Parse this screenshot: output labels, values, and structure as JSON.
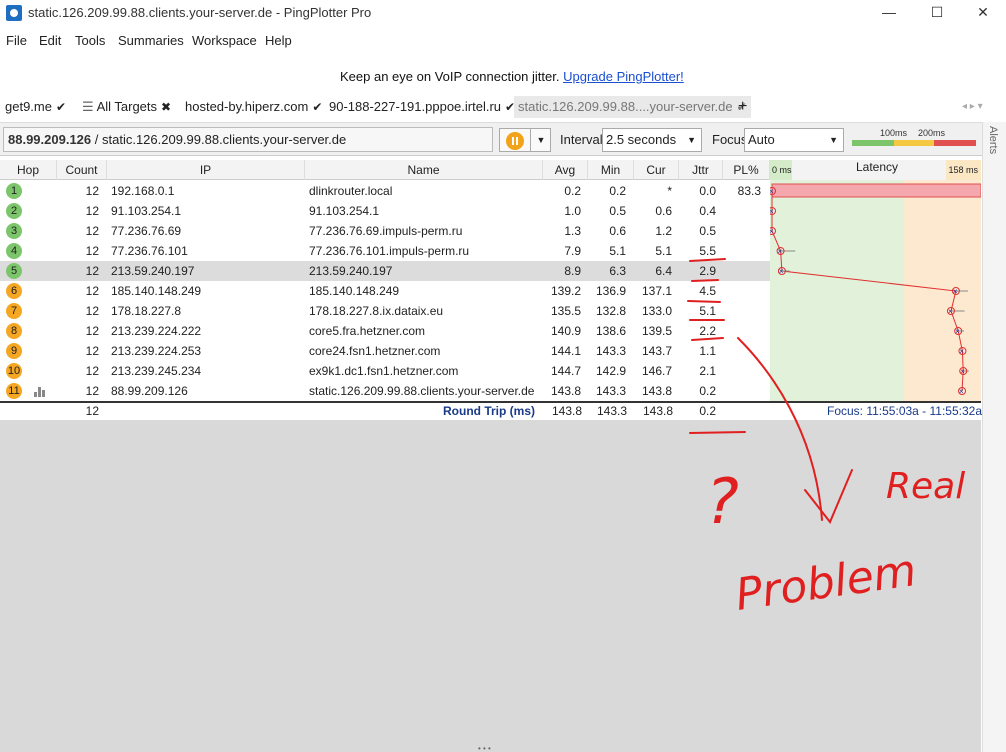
{
  "window": {
    "title": "static.126.209.99.88.clients.your-server.de - PingPlotter Pro",
    "minimize": "—",
    "maximize": "☐",
    "close": "✕"
  },
  "menu": [
    "File",
    "Edit",
    "Tools",
    "Summaries",
    "Workspace",
    "Help"
  ],
  "banner": {
    "text": "Keep an eye on VoIP connection jitter.",
    "link": "Upgrade PingPlotter!"
  },
  "tabs": [
    {
      "label": "get9.me",
      "mark": "✔"
    },
    {
      "label": "All Targets",
      "mark": "✖"
    },
    {
      "label": "hosted-by.hiperz.com",
      "mark": "✔"
    },
    {
      "label": "90-188-227-191.pppoe.irtel.ru",
      "mark": "✔"
    },
    {
      "label": "static.126.209.99.88....your-server.de",
      "mark": "✔"
    }
  ],
  "add_tab": "+",
  "target": {
    "ip": "88.99.209.126",
    "sep": " / ",
    "host": "static.126.209.99.88.clients.your-server.de"
  },
  "controls": {
    "interval_label": "Interval",
    "interval_value": "2.5 seconds",
    "focus_label": "Focus",
    "focus_value": "Auto",
    "legend_100": "100ms",
    "legend_200": "200ms"
  },
  "alerts_label": "Alerts",
  "columns": {
    "hop": "Hop",
    "count": "Count",
    "ip": "IP",
    "name": "Name",
    "avg": "Avg",
    "min": "Min",
    "cur": "Cur",
    "jttr": "Jttr",
    "pl": "PL%",
    "latency_min": "0 ms",
    "latency": "Latency",
    "latency_max": "158 ms"
  },
  "rows": [
    {
      "hop": "1",
      "count": "12",
      "ip": "192.168.0.1",
      "name": "dlinkrouter.local",
      "avg": "0.2",
      "min": "0.2",
      "cur": "*",
      "jttr": "0.0",
      "pl": "83.3",
      "color": "#7cc56a"
    },
    {
      "hop": "2",
      "count": "12",
      "ip": "91.103.254.1",
      "name": "91.103.254.1",
      "avg": "1.0",
      "min": "0.5",
      "cur": "0.6",
      "jttr": "0.4",
      "pl": "",
      "color": "#7cc56a"
    },
    {
      "hop": "3",
      "count": "12",
      "ip": "77.236.76.69",
      "name": "77.236.76.69.impuls-perm.ru",
      "avg": "1.3",
      "min": "0.6",
      "cur": "1.2",
      "jttr": "0.5",
      "pl": "",
      "color": "#7cc56a"
    },
    {
      "hop": "4",
      "count": "12",
      "ip": "77.236.76.101",
      "name": "77.236.76.101.impuls-perm.ru",
      "avg": "7.9",
      "min": "5.1",
      "cur": "5.1",
      "jttr": "5.5",
      "pl": "",
      "color": "#7cc56a"
    },
    {
      "hop": "5",
      "count": "12",
      "ip": "213.59.240.197",
      "name": "213.59.240.197",
      "avg": "8.9",
      "min": "6.3",
      "cur": "6.4",
      "jttr": "2.9",
      "pl": "",
      "color": "#7cc56a"
    },
    {
      "hop": "6",
      "count": "12",
      "ip": "185.140.148.249",
      "name": "185.140.148.249",
      "avg": "139.2",
      "min": "136.9",
      "cur": "137.1",
      "jttr": "4.5",
      "pl": "",
      "color": "#f5a623"
    },
    {
      "hop": "7",
      "count": "12",
      "ip": "178.18.227.8",
      "name": "178.18.227.8.ix.dataix.eu",
      "avg": "135.5",
      "min": "132.8",
      "cur": "133.0",
      "jttr": "5.1",
      "pl": "",
      "color": "#f5a623"
    },
    {
      "hop": "8",
      "count": "12",
      "ip": "213.239.224.222",
      "name": "core5.fra.hetzner.com",
      "avg": "140.9",
      "min": "138.6",
      "cur": "139.5",
      "jttr": "2.2",
      "pl": "",
      "color": "#f5a623"
    },
    {
      "hop": "9",
      "count": "12",
      "ip": "213.239.224.253",
      "name": "core24.fsn1.hetzner.com",
      "avg": "144.1",
      "min": "143.3",
      "cur": "143.7",
      "jttr": "1.1",
      "pl": "",
      "color": "#f5a623"
    },
    {
      "hop": "10",
      "count": "12",
      "ip": "213.239.245.234",
      "name": "ex9k1.dc1.fsn1.hetzner.com",
      "avg": "144.7",
      "min": "142.9",
      "cur": "146.7",
      "jttr": "2.1",
      "pl": "",
      "color": "#f5a623"
    },
    {
      "hop": "11",
      "count": "12",
      "ip": "88.99.209.126",
      "name": "static.126.209.99.88.clients.your-server.de",
      "avg": "143.8",
      "min": "143.3",
      "cur": "143.8",
      "jttr": "0.2",
      "pl": "",
      "color": "#f5a623"
    }
  ],
  "round_trip": {
    "count": "12",
    "label": "Round Trip (ms)",
    "avg": "143.8",
    "min": "143.3",
    "cur": "143.8",
    "jttr": "0.2",
    "focus": "Focus: 11:55:03a - 11:55:32a"
  },
  "annotation": {
    "question": "?",
    "text1": "Real",
    "text2": "Problem"
  },
  "colors": {
    "good": "#7cc56a",
    "warn": "#f5a623",
    "bad": "#e05050",
    "annotation": "#e02020"
  }
}
